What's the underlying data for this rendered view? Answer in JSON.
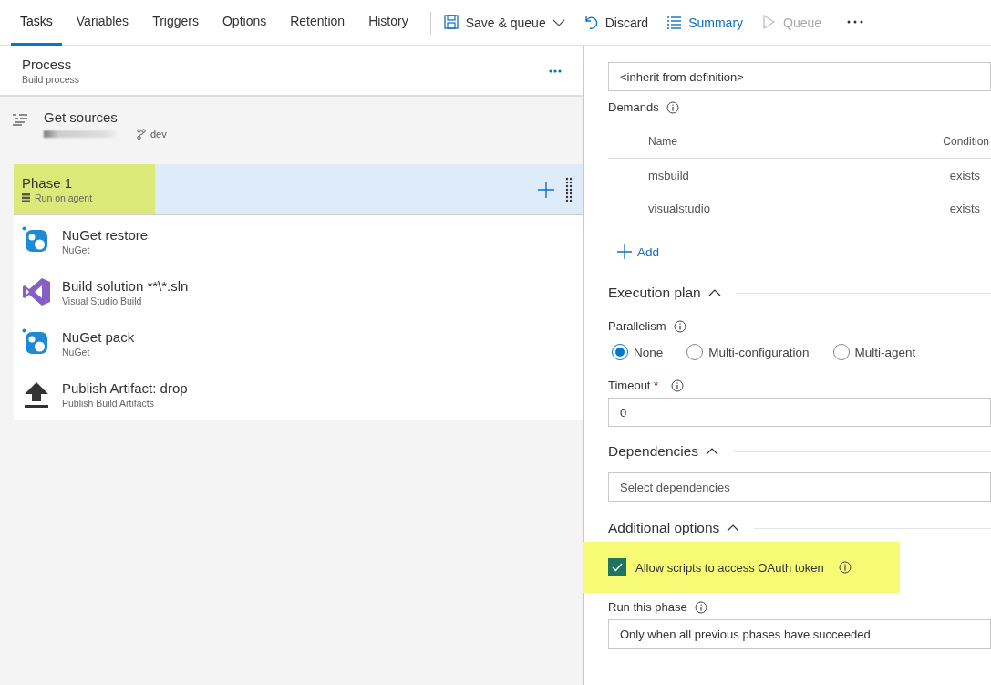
{
  "tabs": [
    {
      "label": "Tasks",
      "selected": true
    },
    {
      "label": "Variables",
      "selected": false
    },
    {
      "label": "Triggers",
      "selected": false
    },
    {
      "label": "Options",
      "selected": false
    },
    {
      "label": "Retention",
      "selected": false
    },
    {
      "label": "History",
      "selected": false
    }
  ],
  "toolbar": [
    {
      "kind": "save",
      "label": "Save & queue",
      "disabled": false
    },
    {
      "kind": "discard",
      "label": "Discard",
      "disabled": false
    },
    {
      "kind": "summary",
      "label": "Summary",
      "disabled": false
    },
    {
      "kind": "queue",
      "label": "Queue",
      "disabled": true
    }
  ],
  "process": {
    "title": "Process",
    "subtitle": "Build process"
  },
  "get_sources": {
    "title": "Get sources",
    "branch": "dev"
  },
  "phase": {
    "title": "Phase 1",
    "subtitle": "Run on agent",
    "selected": true,
    "highlighted": true
  },
  "tasks": [
    {
      "kind": "nuget",
      "title": "NuGet restore",
      "subtitle": "NuGet"
    },
    {
      "kind": "vs",
      "title": "Build solution **\\*.sln",
      "subtitle": "Visual Studio Build"
    },
    {
      "kind": "nuget",
      "title": "NuGet pack",
      "subtitle": "NuGet"
    },
    {
      "kind": "upload",
      "title": "Publish Artifact: drop",
      "subtitle": "Publish Build Artifacts"
    }
  ],
  "agent_queue": {
    "value": "<inherit from definition>"
  },
  "demands": {
    "label": "Demands",
    "columns": [
      "Name",
      "Condition"
    ],
    "rows": [
      [
        "msbuild",
        "exists"
      ],
      [
        "visualstudio",
        "exists"
      ]
    ],
    "add": "Add"
  },
  "execution_plan": {
    "title": "Execution plan",
    "parallelism_label": "Parallelism",
    "options": [
      {
        "label": "None",
        "selected": true
      },
      {
        "label": "Multi-configuration",
        "selected": false
      },
      {
        "label": "Multi-agent",
        "selected": false
      }
    ],
    "timeout_label": "Timeout",
    "timeout_required": "*",
    "timeout_value": "0"
  },
  "dependencies": {
    "title": "Dependencies",
    "placeholder": "Select dependencies"
  },
  "additional_options": {
    "title": "Additional options",
    "checkbox": {
      "label": "Allow scripts to access OAuth token",
      "checked": true,
      "highlighted": true
    },
    "run_label": "Run this phase",
    "run_value": "Only when all previous phases have succeeded"
  }
}
